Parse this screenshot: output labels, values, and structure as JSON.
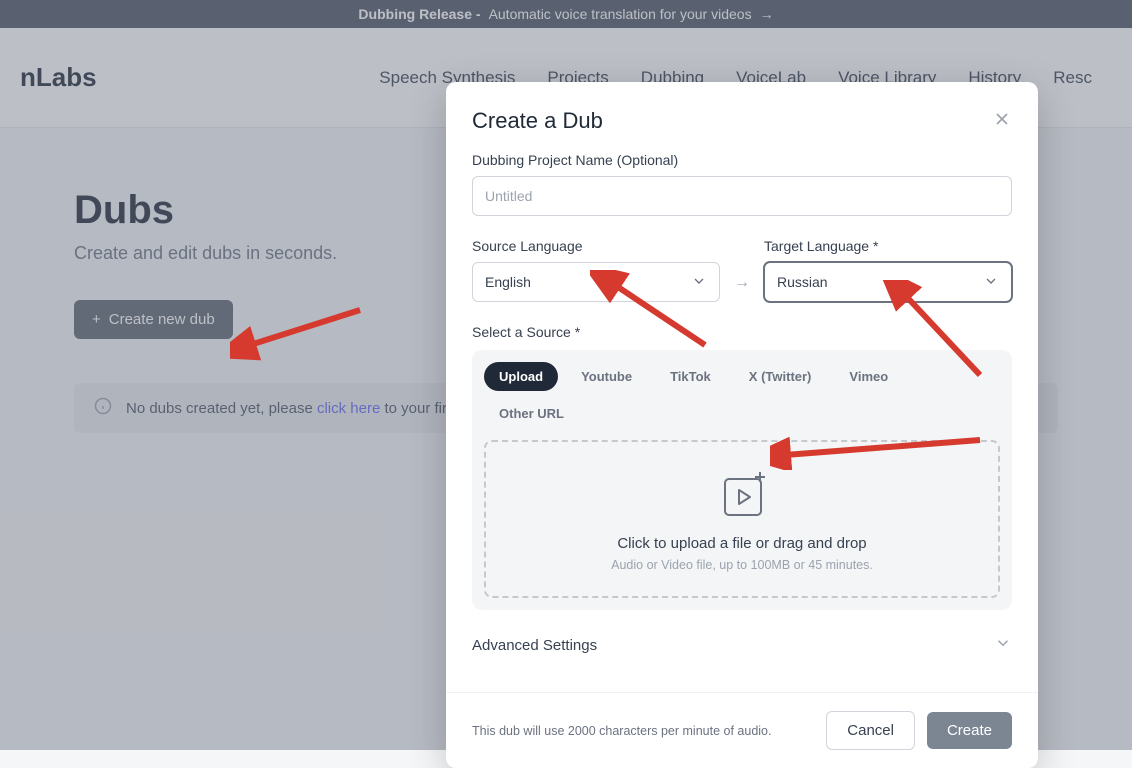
{
  "banner": {
    "bold": "Dubbing Release -",
    "text": "Automatic voice translation for your videos"
  },
  "brand": "nLabs",
  "nav": [
    "Speech Synthesis",
    "Projects",
    "Dubbing",
    "VoiceLab",
    "Voice Library",
    "History",
    "Resc"
  ],
  "page": {
    "title": "Dubs",
    "subtitle": "Create and edit dubs in seconds.",
    "create_btn": "Create new dub",
    "info_prefix": "No dubs created yet, please ",
    "info_link": "click here",
    "info_suffix": " to your first"
  },
  "modal": {
    "title": "Create a Dub",
    "name_label": "Dubbing Project Name (Optional)",
    "name_placeholder": "Untitled",
    "source_lang_label": "Source Language",
    "source_lang_value": "English",
    "target_lang_label": "Target Language *",
    "target_lang_value": "Russian",
    "select_source_label": "Select a Source *",
    "tabs": [
      "Upload",
      "Youtube",
      "TikTok",
      "X (Twitter)",
      "Vimeo",
      "Other URL"
    ],
    "drop_main": "Click to upload a file or drag and drop",
    "drop_sub": "Audio or Video file, up to 100MB or 45 minutes.",
    "advanced": "Advanced Settings",
    "footer_note": "This dub will use 2000 characters per minute of audio.",
    "cancel": "Cancel",
    "create": "Create"
  }
}
